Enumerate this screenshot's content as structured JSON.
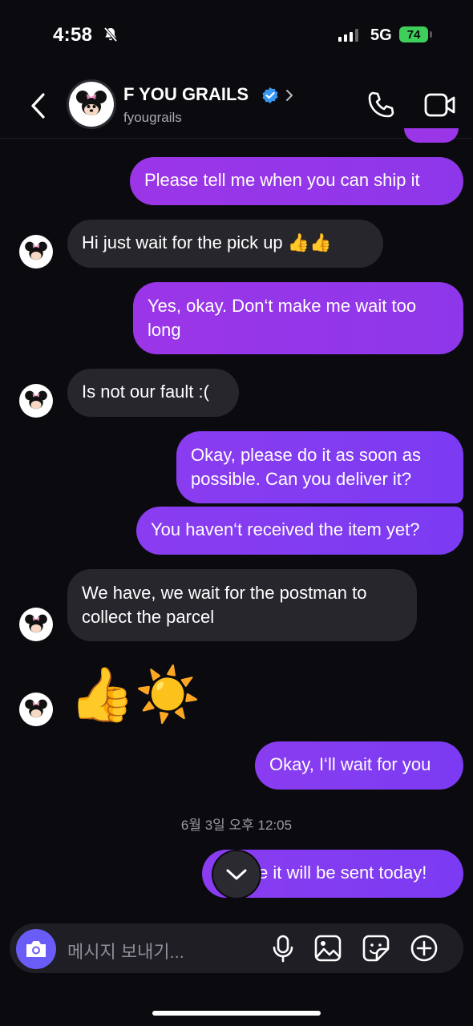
{
  "status": {
    "time": "4:58",
    "network": "5G",
    "battery": "74"
  },
  "header": {
    "name": "F YOU GRAILS",
    "handle": "fyougrails"
  },
  "messages": [
    {
      "dir": "out",
      "text": "Please tell me when you can ship it"
    },
    {
      "dir": "in",
      "text": "Hi just wait for the pick up 👍👍"
    },
    {
      "dir": "out",
      "text": "Yes, okay. Don‘t make me wait too long"
    },
    {
      "dir": "in",
      "text": "Is not our fault :("
    },
    {
      "dir": "out",
      "text": "Okay, please do it as soon as possible. Can you deliver it?"
    },
    {
      "dir": "out",
      "text": "You haven‘t received the item yet?"
    },
    {
      "dir": "in",
      "text": "We have, we wait for the postman to collect the parcel"
    },
    {
      "dir": "in",
      "text": "👍☀️"
    },
    {
      "dir": "out",
      "text": "Okay, I‘ll wait for you"
    },
    {
      "dir": "out",
      "text": "e it will be sent today!"
    }
  ],
  "timestamp": "6월 3일 오후 12:05",
  "composer": {
    "placeholder": "메시지 보내기..."
  },
  "icons": {
    "back": "chevron-left-icon",
    "verified": "verified-badge-icon",
    "call": "phone-icon",
    "video": "video-camera-icon",
    "camera": "camera-icon",
    "mic": "microphone-icon",
    "gallery": "image-icon",
    "sticker": "sticker-icon",
    "add": "plus-circle-icon",
    "scroll": "chevron-down-icon"
  },
  "colors": {
    "outgoing": "#8a3cf0",
    "incoming": "#26262c",
    "background": "#0b0b0f",
    "verified": "#3897f0"
  }
}
